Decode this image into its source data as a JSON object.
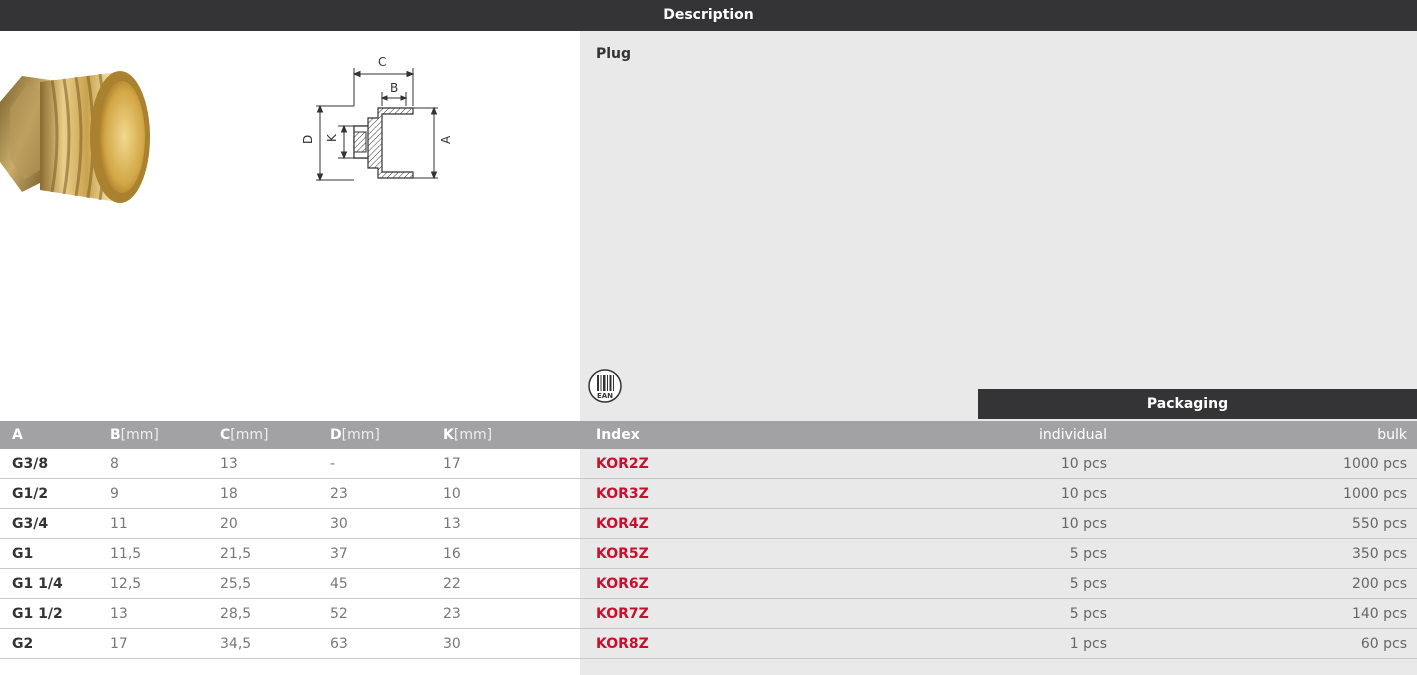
{
  "header": {
    "title": "Description"
  },
  "product": {
    "title": "Plug"
  },
  "drawing": {
    "labels": {
      "a": "A",
      "b": "B",
      "c": "C",
      "d": "D",
      "k": "K"
    }
  },
  "ean": {
    "label": "EAN"
  },
  "packaging": {
    "title": "Packaging"
  },
  "table": {
    "headers": {
      "a": "A",
      "b": "B",
      "b_unit": "[mm]",
      "c": "C",
      "c_unit": "[mm]",
      "d": "D",
      "d_unit": "[mm]",
      "k": "K",
      "k_unit": "[mm]",
      "index": "Index",
      "individual": "individual",
      "bulk": "bulk"
    },
    "rows": [
      {
        "a": "G3/8",
        "b": "8",
        "c": "13",
        "d": "-",
        "k": "17",
        "index": "KOR2Z",
        "individual": "10 pcs",
        "bulk": "1000 pcs"
      },
      {
        "a": "G1/2",
        "b": "9",
        "c": "18",
        "d": "23",
        "k": "10",
        "index": "KOR3Z",
        "individual": "10 pcs",
        "bulk": "1000 pcs"
      },
      {
        "a": "G3/4",
        "b": "11",
        "c": "20",
        "d": "30",
        "k": "13",
        "index": "KOR4Z",
        "individual": "10 pcs",
        "bulk": "550 pcs"
      },
      {
        "a": "G1",
        "b": "11,5",
        "c": "21,5",
        "d": "37",
        "k": "16",
        "index": "KOR5Z",
        "individual": "5 pcs",
        "bulk": "350 pcs"
      },
      {
        "a": "G1 1/4",
        "b": "12,5",
        "c": "25,5",
        "d": "45",
        "k": "22",
        "index": "KOR6Z",
        "individual": "5 pcs",
        "bulk": "200 pcs"
      },
      {
        "a": "G1 1/2",
        "b": "13",
        "c": "28,5",
        "d": "52",
        "k": "23",
        "index": "KOR7Z",
        "individual": "5 pcs",
        "bulk": "140 pcs"
      },
      {
        "a": "G2",
        "b": "17",
        "c": "34,5",
        "d": "63",
        "k": "30",
        "index": "KOR8Z",
        "individual": "1 pcs",
        "bulk": "60 pcs"
      }
    ]
  },
  "colors": {
    "dark_bar": "#343436",
    "header_row": "#a2a2a4",
    "index_red": "#c8102e",
    "panel": "#e9e9ea"
  }
}
